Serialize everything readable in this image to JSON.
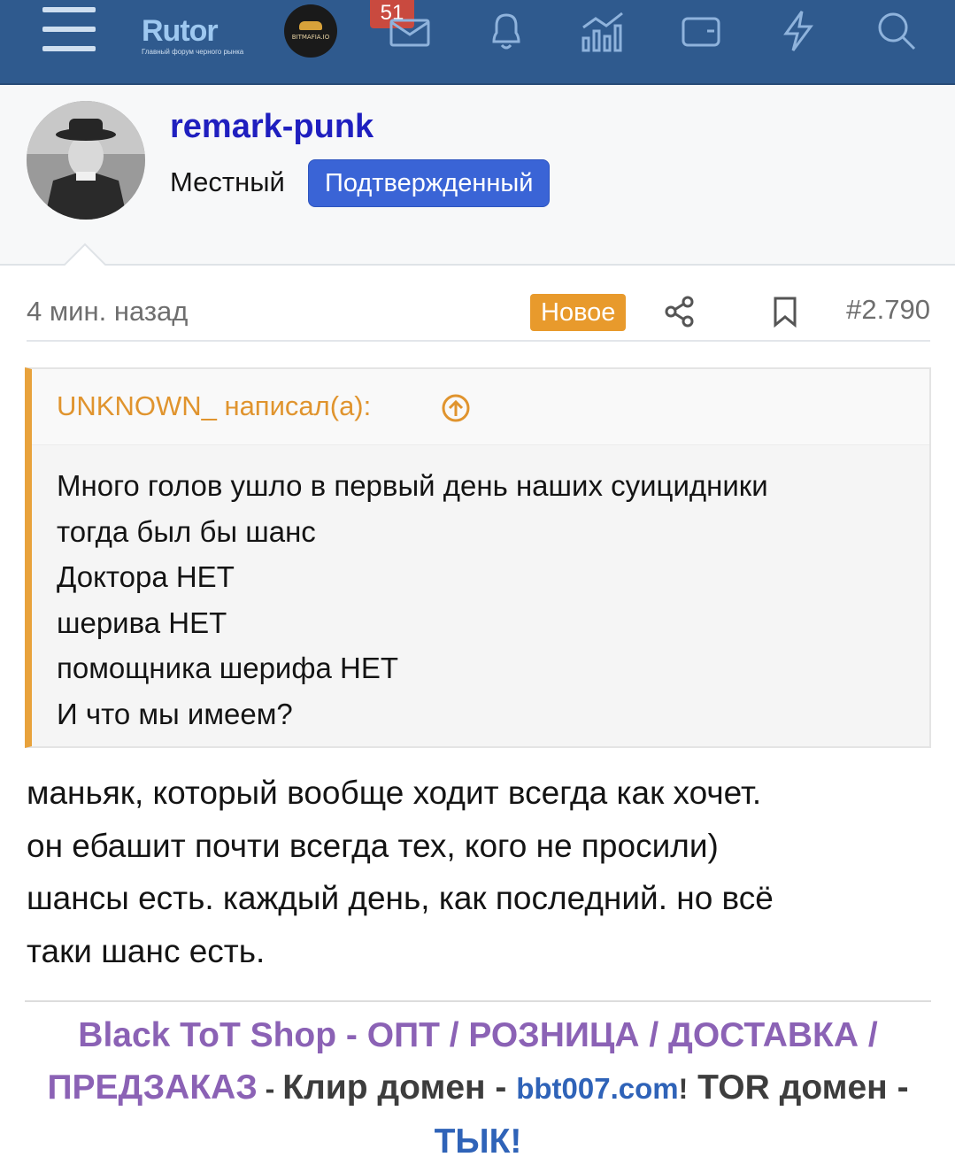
{
  "nav": {
    "logo_text": "Rutor",
    "logo_subtitle": "Главный форум черного рынка",
    "partner_label": "BITMAFIA.IO",
    "inbox_count": "51",
    "icons": [
      "menu-icon",
      "envelope-icon",
      "bell-icon",
      "stats-icon",
      "wallet-icon",
      "lightning-icon",
      "search-icon"
    ],
    "bar_color": "#2f5a8e"
  },
  "user": {
    "name": "remark-punk",
    "rank": "Местный",
    "badge": "Подтвержденный",
    "badge_color": "#3a64d6"
  },
  "post": {
    "time": "4 мин. назад",
    "new_label": "Новое",
    "number": "#2.790"
  },
  "quote": {
    "author": "UNKNOWN_ написал(а):",
    "lines": [
      "Много голов ушло в первый день наших суицидники",
      "тогда был бы шанс",
      "Доктора НЕТ",
      "шерива НЕТ",
      "помощника шерифа НЕТ",
      "И что мы имеем?"
    ]
  },
  "reply": {
    "lines": [
      "маньяк, который вообще ходит всегда как хочет.",
      "он ебашит почти всегда тех, кого не просили)",
      "шансы есть. каждый день, как последний. но всё",
      "таки шанс есть."
    ]
  },
  "signature": {
    "shop": "Black ToT Shop - ОПТ / РОЗНИЦА / ДОСТАВКА /",
    "preorder": "ПРЕДЗАКАЗ",
    "sep1": " - ",
    "clear_label": "Клир домен - ",
    "domain": "bbt007.com",
    "exclaim": "!",
    "tor_label": " TOR домен -",
    "tyk": "ТЫК!",
    "accent_color": "#8b62b5",
    "link_color": "#2f63b8"
  }
}
